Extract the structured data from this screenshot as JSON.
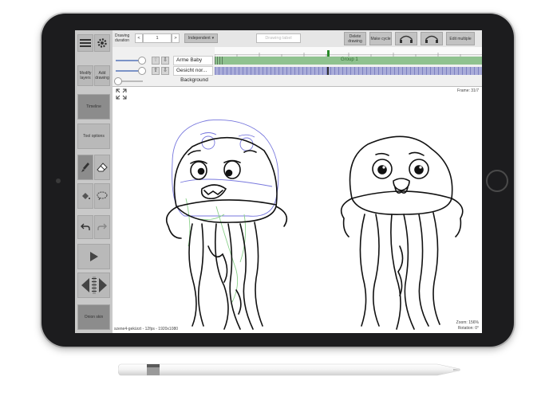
{
  "toolbar": {
    "drawing_duration_label": "Drawing duration",
    "prev_symbol": "<",
    "duration_value": "1",
    "next_symbol": ">",
    "mode_select": "Independent",
    "drawing_label_placeholder": "Drawing label",
    "delete_drawing": "Delete drawing",
    "make_cycle": "Make cycle",
    "edit_multiple": "Edit multiple"
  },
  "sidebar": {
    "modify_layers": "Modify layers",
    "add_drawing": "Add drawing",
    "timeline": "Timeline",
    "tool_options": "Tool options",
    "onion_skin": "Onion skin"
  },
  "layers": {
    "items": [
      {
        "name": "Arme Baby",
        "track_label": "Group 1"
      },
      {
        "name": "Gesicht nor..."
      },
      {
        "name": "Background"
      }
    ]
  },
  "canvas": {
    "frame_label": "Frame: 31/7",
    "zoom_label": "Zoom: 156%",
    "rotation_label": "Rotation: 0°",
    "filename": "szene4-gekürzt - 12fps - 1920x1080"
  },
  "colors": {
    "track_green": "#8fc28f",
    "track_blue": "#a9acd9",
    "onion_blue": "#7777dd",
    "onion_green": "#8ad08a"
  }
}
